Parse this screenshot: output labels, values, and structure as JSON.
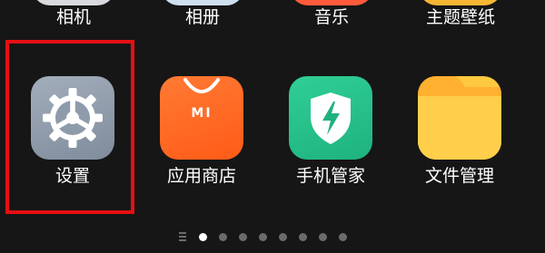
{
  "top_row": [
    {
      "label": "相机",
      "icon": "camera-icon"
    },
    {
      "label": "相册",
      "icon": "gallery-icon"
    },
    {
      "label": "音乐",
      "icon": "music-icon"
    },
    {
      "label": "主题壁纸",
      "icon": "themes-icon"
    }
  ],
  "apps": [
    {
      "label": "设置",
      "icon": "settings-gear-icon",
      "color": "#8e9bab"
    },
    {
      "label": "应用商店",
      "icon": "app-store-bag-icon",
      "color": "#ff6a24",
      "badge_text": "MI"
    },
    {
      "label": "手机管家",
      "icon": "security-shield-icon",
      "color": "#26c08a"
    },
    {
      "label": "文件管理",
      "icon": "folder-icon",
      "color": "#ffc93f"
    }
  ],
  "page_indicator": {
    "total_pages": 8,
    "current_page": 1
  },
  "colors": {
    "highlight": "#e60f12",
    "background": "#161616"
  }
}
